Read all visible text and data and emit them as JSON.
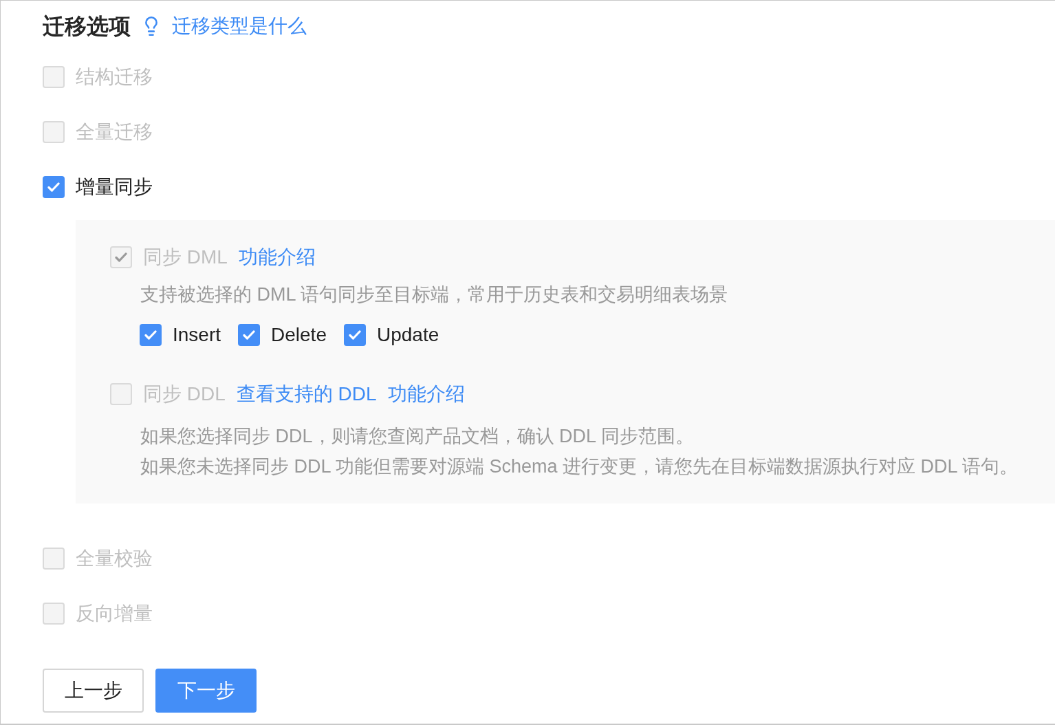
{
  "header": {
    "title": "迁移选项",
    "help_link": "迁移类型是什么"
  },
  "options": [
    {
      "label": "结构迁移",
      "checked": false,
      "disabled": true
    },
    {
      "label": "全量迁移",
      "checked": false,
      "disabled": true
    },
    {
      "label": "增量同步",
      "checked": true,
      "disabled": false,
      "sub_options": [
        {
          "label": "同步 DML",
          "checked": true,
          "disabled": true,
          "links": [
            "功能介绍"
          ],
          "description": [
            "支持被选择的 DML 语句同步至目标端，常用于历史表和交易明细表场景"
          ],
          "operations": [
            {
              "label": "Insert",
              "checked": true,
              "disabled": false
            },
            {
              "label": "Delete",
              "checked": true,
              "disabled": false
            },
            {
              "label": "Update",
              "checked": true,
              "disabled": false
            }
          ]
        },
        {
          "label": "同步 DDL",
          "checked": false,
          "disabled": true,
          "links": [
            "查看支持的 DDL",
            "功能介绍"
          ],
          "description": [
            "如果您选择同步 DDL，则请您查阅产品文档，确认 DDL 同步范围。",
            "如果您未选择同步 DDL 功能但需要对源端 Schema 进行变更，请您先在目标端数据源执行对应 DDL 语句。"
          ]
        }
      ]
    },
    {
      "label": "全量校验",
      "checked": false,
      "disabled": true
    },
    {
      "label": "反向增量",
      "checked": false,
      "disabled": true
    }
  ],
  "buttons": [
    {
      "label": "上一步",
      "kind": "secondary"
    },
    {
      "label": "下一步",
      "kind": "primary"
    }
  ]
}
